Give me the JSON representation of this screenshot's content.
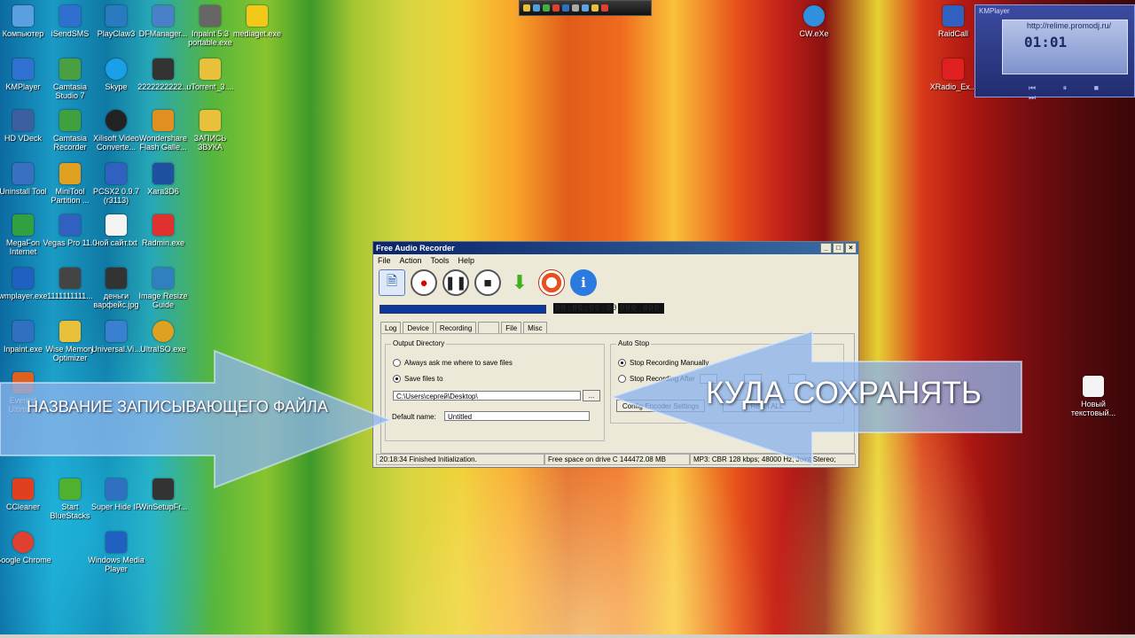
{
  "desktop_icons": [
    {
      "label": "Компьютер",
      "color": "#5aa0e0"
    },
    {
      "label": "iSendSMS",
      "color": "#2f6fd0"
    },
    {
      "label": "PlayClaw3",
      "color": "#2a7ac0"
    },
    {
      "label": "DFManager...",
      "color": "#4a80c8"
    },
    {
      "label": "Inpaint 5.3 portable.exe",
      "color": "#666666"
    },
    {
      "label": "mediaget.exe",
      "color": "#f2c81a"
    },
    {
      "label": "KMPlayer",
      "color": "#3070d0"
    },
    {
      "label": "Camtasia Studio 7",
      "color": "#4aa040"
    },
    {
      "label": "Skype",
      "color": "#1aa0e8"
    },
    {
      "label": "2222222222...",
      "color": "#333333"
    },
    {
      "label": "uTorrent_3....",
      "color": "#e8c03a"
    },
    {
      "label": "HD VDeck",
      "color": "#3a60a0"
    },
    {
      "label": "Camtasia Recorder",
      "color": "#40a040"
    },
    {
      "label": "Xilisoft Video Converte...",
      "color": "#222222"
    },
    {
      "label": "Wondershare Flash Galle...",
      "color": "#e09020"
    },
    {
      "label": "ЗАПИСЬ ЗВУКА",
      "color": "#e8c03a"
    },
    {
      "label": "Uninstall Tool",
      "color": "#3a70c0"
    },
    {
      "label": "MiniTool Partition ...",
      "color": "#e0a020"
    },
    {
      "label": "PCSX2 0.9.7 (r3113)",
      "color": "#3060c0"
    },
    {
      "label": "Xara3D6",
      "color": "#2050a0"
    },
    {
      "label": "MegaFon Internet",
      "color": "#30a040"
    },
    {
      "label": "Vegas Pro 11.0",
      "color": "#3060c0"
    },
    {
      "label": "ной сайт.txt",
      "color": "#f4f4f4"
    },
    {
      "label": "Radmin.exe",
      "color": "#e03030"
    },
    {
      "label": "wmplayer.exe",
      "color": "#2060c0"
    },
    {
      "label": "1111111111...",
      "color": "#444444"
    },
    {
      "label": "деньги варфейс.jpg",
      "color": "#333333"
    },
    {
      "label": "Image Resize Guide",
      "color": "#3080c0"
    },
    {
      "label": "Inpaint.exe",
      "color": "#3070c0"
    },
    {
      "label": "Wise Memory Optimizer",
      "color": "#e8c03a"
    },
    {
      "label": "Universal.Vi...",
      "color": "#3a80d0"
    },
    {
      "label": "UltraISO.exe",
      "color": "#e0a020"
    },
    {
      "label": "Everest Ultimate",
      "color": "#e06020"
    },
    {
      "label": "CCleaner",
      "color": "#e04020"
    },
    {
      "label": "Start BlueStacks",
      "color": "#50b030"
    },
    {
      "label": "Super Hide IP",
      "color": "#3070c0"
    },
    {
      "label": "WinSetupFr...",
      "color": "#333333"
    },
    {
      "label": "Google Chrome",
      "color": "#e04030"
    },
    {
      "label": "Windows Media Player",
      "color": "#2060c0"
    },
    {
      "label": "RaidCall",
      "color": "#3060c0"
    },
    {
      "label": "XRadio_Ex...",
      "color": "#e02020"
    },
    {
      "label": "CW.eXe",
      "color": "#3090e0"
    },
    {
      "label": "Новый текстовый...",
      "color": "#f4f4f4"
    }
  ],
  "kmplayer": {
    "title": "KMPlayer",
    "url": "http://relime.promodj.ru/",
    "time": "01:01",
    "controls": "⏮ ⏸ ■ ⏭"
  },
  "window": {
    "title": "Free Audio Recorder",
    "menu": [
      "File",
      "Action",
      "Tools",
      "Help"
    ],
    "tabs": [
      "Log",
      "Device",
      "Recording",
      "File",
      "Misc"
    ],
    "output_directory": {
      "legend": "Output Directory",
      "option_always": "Always ask me where to save files",
      "option_save": "Save files to",
      "path": "C:\\Users\\сергей\\Desktop\\",
      "browse": "...",
      "default_name_label": "Default name:",
      "default_name_value": "Untitled"
    },
    "auto_stop": {
      "legend": "Auto Stop",
      "option_manual": "Stop Recording Manually",
      "option_after": "Stop Recording After"
    },
    "buttons": {
      "config": "Config Encoder Settings",
      "reset": "Reset ALL"
    },
    "status": {
      "time": "20:18:34  Finished Initialization.",
      "space": "Free space on drive C  144472.08 MB",
      "format": "MP3:  CBR 128 kbps; 48000 Hz; Joint Stereo;"
    }
  },
  "annotations": {
    "left": "НАЗВАНИЕ ЗАПИСЫВАЮЩЕГО ФАЙЛА",
    "right": "КУДА СОХРАНЯТЬ"
  }
}
